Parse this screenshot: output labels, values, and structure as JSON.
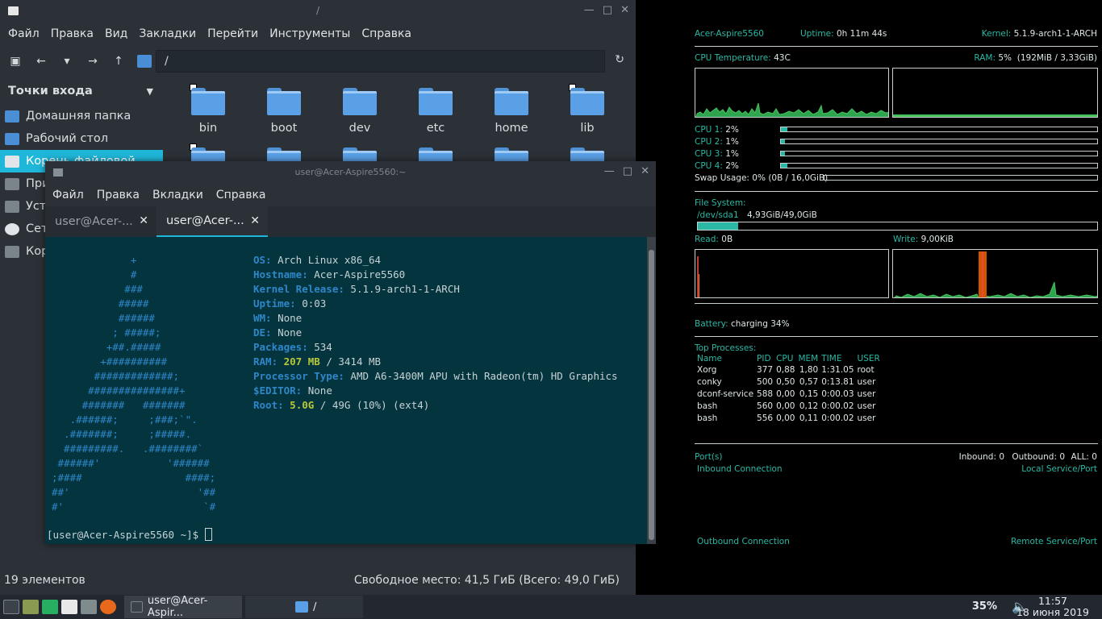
{
  "file_manager": {
    "title": "/",
    "menu": [
      "Файл",
      "Правка",
      "Вид",
      "Закладки",
      "Перейти",
      "Инструменты",
      "Справка"
    ],
    "path": "/",
    "sidebar_title": "Точки входа",
    "sidebar_items": [
      "Домашняя папка",
      "Рабочий стол",
      "Корень файловой",
      "При",
      "Уст",
      "Сет",
      "Кор"
    ],
    "folders_row1": [
      "bin",
      "boot",
      "dev",
      "etc",
      "home",
      "lib"
    ],
    "status_left": "19 элементов",
    "status_right": "Свободное место: 41,5 ГиБ (Всего: 49,0 ГиБ)"
  },
  "terminal": {
    "title": "user@Acer-Aspire5560:~",
    "menu": [
      "Файл",
      "Правка",
      "Вкладки",
      "Справка"
    ],
    "tabs": [
      "user@Acer-...",
      "user@Acer-..."
    ],
    "art": [
      "             +",
      "             #",
      "            ###",
      "           #####",
      "           ######",
      "          ; #####;",
      "         +##.#####",
      "        +##########",
      "       #############;",
      "      ###############+",
      "     #######   #######",
      "   .######;     ;###;`\".",
      "  .#######;     ;#####.",
      "  #########.   .########`",
      " ######'           '######",
      ";####                 ####;",
      "##'                     '##",
      "#'                       `#"
    ],
    "info": [
      {
        "k": "OS:",
        "v": " Arch Linux x86_64"
      },
      {
        "k": "Hostname:",
        "v": " Acer-Aspire5560"
      },
      {
        "k": "Kernel Release:",
        "v": " 5.1.9-arch1-1-ARCH"
      },
      {
        "k": "Uptime:",
        "v": " 0:03"
      },
      {
        "k": "WM:",
        "v": " None"
      },
      {
        "k": "DE:",
        "v": " None"
      },
      {
        "k": "Packages:",
        "v": " 534"
      },
      {
        "k": "RAM:",
        "g": " 207 MB",
        "v": " / 3414 MB"
      },
      {
        "k": "Processor Type:",
        "v": " AMD A6-3400M APU with Radeon(tm) HD Graphics"
      },
      {
        "k": "$EDITOR:",
        "v": " None"
      },
      {
        "k": "Root:",
        "g": " 5.0G",
        "v": " / 49G (10%) (ext4)"
      }
    ],
    "prompt": "[user@Acer-Aspire5560 ~]$ "
  },
  "conky": {
    "host": "Acer-Aspire5560",
    "uptime_label": "Uptime:",
    "uptime": "0h 11m 44s",
    "kernel_label": "Kernel:",
    "kernel": "5.1.9-arch1-1-ARCH",
    "cpu_temp_label": "CPU Temperature:",
    "cpu_temp": "43C",
    "ram_label": "RAM:",
    "ram_pct": "5%",
    "ram_detail": "(192MiB / 3,33GiB)",
    "cpus": [
      {
        "label": "CPU 1:",
        "value": "2%",
        "pct": 2
      },
      {
        "label": "CPU 2:",
        "value": "1%",
        "pct": 1
      },
      {
        "label": "CPU 3:",
        "value": "1%",
        "pct": 1
      },
      {
        "label": "CPU 4:",
        "value": "2%",
        "pct": 2
      }
    ],
    "swap_label": "Swap Usage:",
    "swap": "0%",
    "swap_detail": "(0B / 16,0GiB)",
    "fs_label": "File System:",
    "fs_dev": "/dev/sda1",
    "fs_usage": "4,93GiB/49,0GiB",
    "fs_pct": 10,
    "read_label": "Read:",
    "read": "0B",
    "write_label": "Write:",
    "write": "9,00KiB",
    "battery_label": "Battery:",
    "battery": "charging 34%",
    "top_label": "Top Processes:",
    "proc_headers": [
      "Name",
      "PID",
      "CPU",
      "MEM",
      "TIME",
      "USER"
    ],
    "processes": [
      [
        "Xorg",
        "377",
        "0,88",
        "1,80",
        "1:31.05",
        "root"
      ],
      [
        "conky",
        "500",
        "0,50",
        "0,57",
        "0:13.81",
        "user"
      ],
      [
        "dconf-service",
        "588",
        "0,00",
        "0,15",
        "0:00.03",
        "user"
      ],
      [
        "bash",
        "560",
        "0,00",
        "0,12",
        "0:00.02",
        "user"
      ],
      [
        "bash",
        "556",
        "0,00",
        "0,11",
        "0:00.02",
        "user"
      ]
    ],
    "ports_label": "Port(s)",
    "inbound": "Inbound: 0",
    "outbound": "Outbound: 0",
    "all": "ALL: 0",
    "inbound_conn": "Inbound Connection",
    "local_service": "Local Service/Port",
    "outbound_conn": "Outbound Connection",
    "remote_service": "Remote Service/Port"
  },
  "taskbar": {
    "tasks": [
      "user@Acer-Aspir...",
      "/"
    ],
    "battery": "35%",
    "time": "11:57",
    "date": "18 июня 2019"
  }
}
